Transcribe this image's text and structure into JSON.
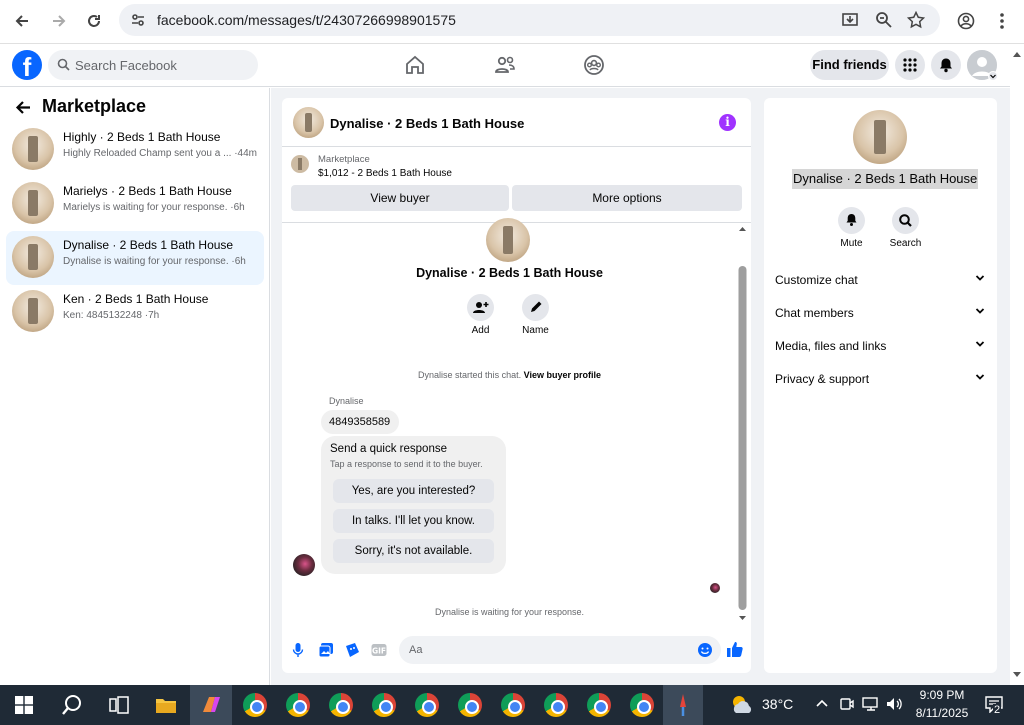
{
  "browser": {
    "url": "facebook.com/messages/t/24307266998901575"
  },
  "fb": {
    "search_placeholder": "Search Facebook",
    "find_friends": "Find friends"
  },
  "left": {
    "title": "Marketplace",
    "conversations": [
      {
        "title": "Highly · 2 Beds 1 Bath House",
        "sub": "Highly Reloaded Champ sent you a ... ·44m"
      },
      {
        "title": "Marielys · 2 Beds 1 Bath House",
        "sub": "Marielys is waiting for your response. ·6h"
      },
      {
        "title": "Dynalise · 2 Beds 1 Bath House",
        "sub": "Dynalise is waiting for your response. ·6h"
      },
      {
        "title": "Ken · 2 Beds 1 Bath House",
        "sub": "Ken: 4845132248 ·7h"
      }
    ]
  },
  "chat": {
    "header_title": "Dynalise · 2 Beds 1 Bath House",
    "listing_label": "Marketplace",
    "listing_detail": "$1,012 - 2 Beds 1 Bath House",
    "view_buyer": "View buyer",
    "more_options": "More options",
    "profile_name": "Dynalise · 2 Beds 1 Bath House",
    "add_label": "Add",
    "name_label": "Name",
    "started_text": "Dynalise started this chat.",
    "view_profile_link": "View buyer profile",
    "sender": "Dynalise",
    "message": "4849358589",
    "quick_title": "Send a quick response",
    "quick_sub": "Tap a response to send it to the buyer.",
    "quick_replies": [
      "Yes, are you interested?",
      "In talks. I'll let you know.",
      "Sorry, it's not available."
    ],
    "waiting_text": "Dynalise is waiting for your response.",
    "input_placeholder": "Aa"
  },
  "right": {
    "name": "Dynalise · 2 Beds 1 Bath House",
    "mute": "Mute",
    "search": "Search",
    "sections": [
      "Customize chat",
      "Chat members",
      "Media, files and links",
      "Privacy & support"
    ]
  },
  "taskbar": {
    "temperature": "38°C",
    "time": "9:09 PM",
    "date": "8/11/2025",
    "notifications": "2"
  },
  "colors": {
    "fb_blue": "#0866ff",
    "info_purple": "#a033ff",
    "active_row": "#ebf5ff"
  }
}
